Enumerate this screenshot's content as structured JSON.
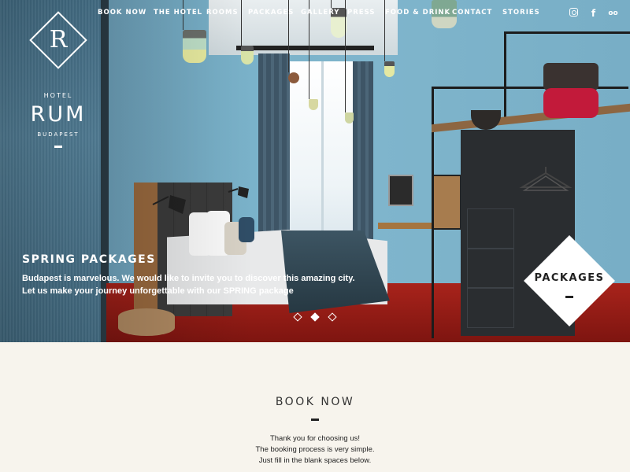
{
  "nav": {
    "items": [
      {
        "label": "BOOK NOW"
      },
      {
        "label": "THE HOTEL"
      },
      {
        "label": "ROOMS"
      },
      {
        "label": "PACKAGES"
      },
      {
        "label": "GALLERY"
      },
      {
        "label": "PRESS"
      },
      {
        "label": "FOOD & DRINK"
      },
      {
        "label": "CONTACT"
      },
      {
        "label": "STORIES"
      }
    ]
  },
  "social": {
    "icons": [
      "instagram-icon",
      "facebook-icon",
      "tripadvisor-icon"
    ],
    "facebook_glyph": "f",
    "tripadvisor_glyph": "oo"
  },
  "logo": {
    "letter": "R",
    "hotel": "HOTEL",
    "name": "RUM",
    "city": "BUDAPEST"
  },
  "hero": {
    "title": "SPRING PACKAGES",
    "line1": "Budapest is marvelous. We would like to invite you to discover this amazing city.",
    "line2": "Let us make your journey unforgettable with our SPRING package",
    "slides": 3,
    "active_slide": 2
  },
  "badge": {
    "label": "PACKAGES"
  },
  "booking": {
    "title": "BOOK NOW",
    "lines": [
      "Thank you for choosing us!",
      "The booking process is very simple.",
      "Just fill in the blank spaces below."
    ]
  },
  "colors": {
    "page_background": "#f7f4ed",
    "hero_wall": "#7fb5cc",
    "floor_red": "#a8231b",
    "text_dark": "#222222"
  }
}
